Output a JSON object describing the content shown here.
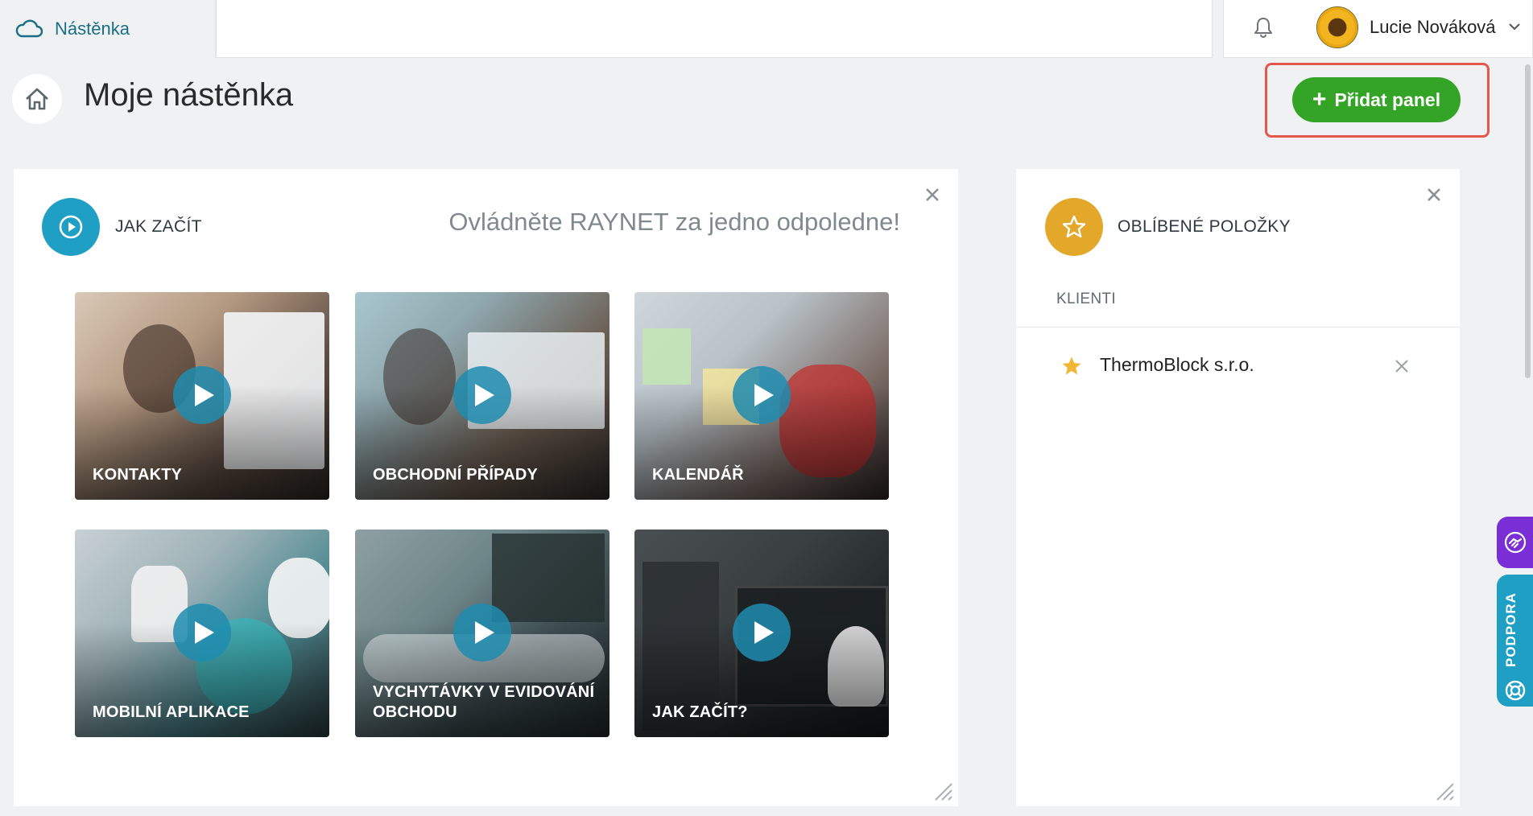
{
  "breadcrumb": {
    "label": "Nástěnka",
    "icon": "cloud-icon"
  },
  "user": {
    "name": "Lucie Nováková"
  },
  "page": {
    "title": "Moje nástěnka",
    "add_panel_label": "Přidat panel"
  },
  "colors": {
    "accent": "#1f9fc4",
    "add_button": "#34a426",
    "favorite": "#e3a72a",
    "highlight": "#e4574d",
    "purple": "#7a2fd6"
  },
  "getting_started": {
    "title": "JAK ZAČÍT",
    "tagline": "Ovládněte RAYNET za jedno odpoledne!",
    "videos": [
      {
        "label": "KONTAKTY"
      },
      {
        "label": "OBCHODNÍ PŘÍPADY"
      },
      {
        "label": "KALENDÁŘ"
      },
      {
        "label": "MOBILNÍ APLIKACE"
      },
      {
        "label": "VYCHYTÁVKY V EVIDOVÁNÍ OBCHODU"
      },
      {
        "label": "JAK ZAČÍT?"
      }
    ]
  },
  "favorites": {
    "title": "OBLÍBENÉ POLOŽKY",
    "section": "KLIENTI",
    "items": [
      {
        "name": "ThermoBlock s.r.o."
      }
    ]
  },
  "side_tabs": {
    "support_label": "PODPORA"
  }
}
